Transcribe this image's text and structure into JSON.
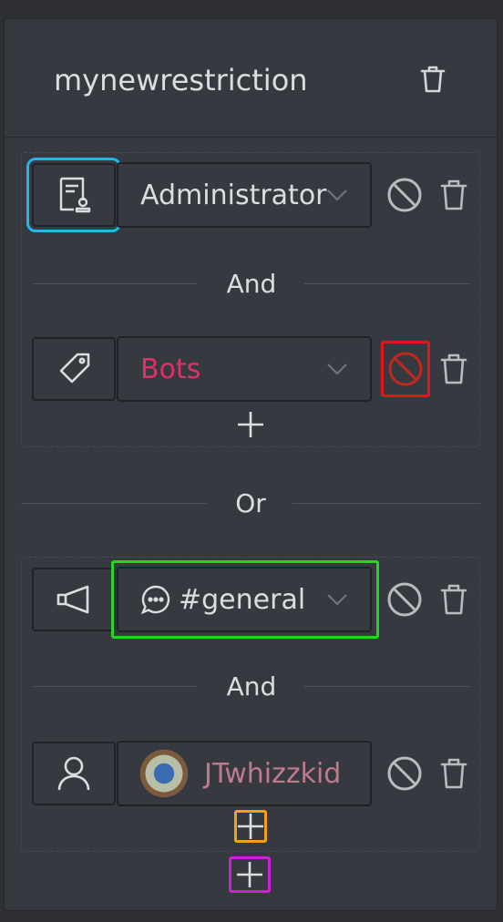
{
  "restriction": {
    "name": "mynewrestriction"
  },
  "groups": [
    {
      "conditions": [
        {
          "type_icon": "role-badge-icon",
          "value": "Administrator",
          "value_color": "#dcddde"
        },
        {
          "type_icon": "tag-icon",
          "value": "Bots",
          "value_color": "#e0306a"
        }
      ],
      "joiner": "And"
    },
    {
      "conditions": [
        {
          "type_icon": "megaphone-icon",
          "value": "#general",
          "value_color": "#dcddde",
          "value_icon": "chat-bubble-icon"
        },
        {
          "type_icon": "user-icon",
          "value": "JTwhizzkid",
          "value_color": "#c07a8e",
          "value_icon": "avatar"
        }
      ],
      "joiner": "And"
    }
  ],
  "group_joiner": "Or"
}
